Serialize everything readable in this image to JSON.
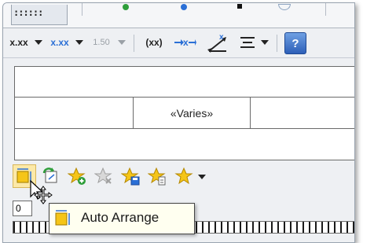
{
  "toolbar": {
    "format_a": "x.xx",
    "format_b": "x.xx",
    "format_c": "1.50",
    "format_d": "(xx)",
    "help_label": "?"
  },
  "grid": {
    "middle_value": "«Varies»"
  },
  "field": {
    "value": "0"
  },
  "tooltip": {
    "label": "Auto Arrange"
  },
  "colors": {
    "accent_yellow": "#f5c518",
    "accent_blue": "#2a6fd6",
    "accent_green": "#2e9e3a",
    "highlight": "#fce9a8"
  }
}
